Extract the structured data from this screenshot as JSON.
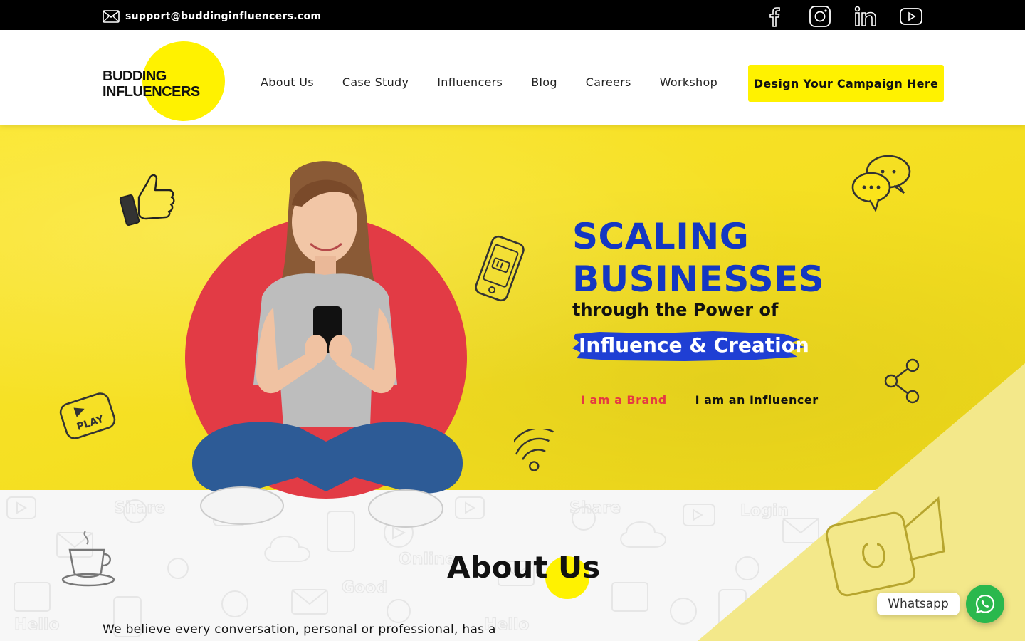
{
  "topbar": {
    "email": "support@buddinginfluencers.com",
    "email_icon": "envelope-icon",
    "social_icons": [
      "facebook-icon",
      "instagram-icon",
      "linkedin-icon",
      "youtube-icon"
    ]
  },
  "header": {
    "logo_line1": "BUDDING",
    "logo_line2": "INFLUENCERS",
    "nav": [
      "About Us",
      "Case Study",
      "Influencers",
      "Blog",
      "Careers",
      "Workshop"
    ],
    "cta": "Design Your Campaign Here"
  },
  "hero": {
    "title_line1": "SCALING",
    "title_line2": "BUSINESSES",
    "subtitle": "through the Power of",
    "highlight": "Influence & Creation",
    "brand_link": "I am a Brand",
    "influencer_link": "I am an Influencer",
    "doodle_play": "PLAY"
  },
  "about": {
    "title": "About Us",
    "text": "We believe every conversation, personal or professional, has a"
  },
  "whatsapp": {
    "label": "Whatsapp",
    "icon": "whatsapp-icon"
  },
  "colors": {
    "brand_yellow": "#fff200",
    "hero_yellow": "#fbe41a",
    "title_blue": "#1437c2",
    "accent_red": "#e53943",
    "whatsapp_green": "#2ab84d"
  }
}
